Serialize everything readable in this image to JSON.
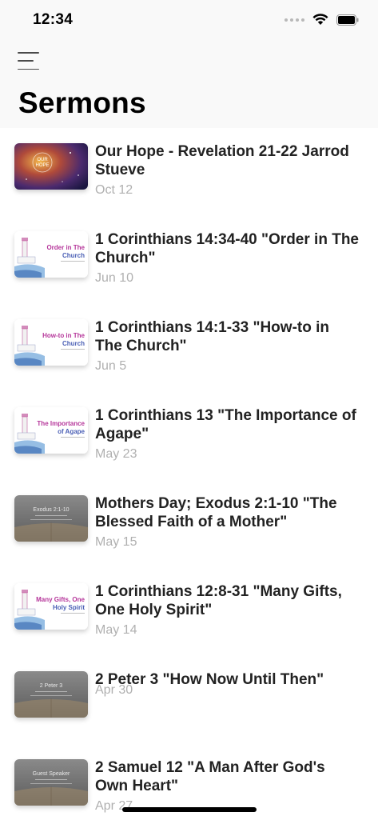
{
  "status_bar": {
    "time": "12:34"
  },
  "header": {
    "title": "Sermons"
  },
  "sermons": [
    {
      "title": "Our Hope - Revelation 21-22 Jarrod Stueve",
      "date": "Oct 12",
      "thumb": {
        "style": "space",
        "line1": "OUR",
        "line2": "HOPE",
        "caption": ""
      }
    },
    {
      "title": "1 Corinthians 14:34-40 \"Order in The Church\"",
      "date": "Jun 10",
      "thumb": {
        "style": "lighthouse",
        "line1": "Order in The",
        "line2": "Church",
        "caption": ""
      }
    },
    {
      "title": "1 Corinthians 14:1-33 \"How-to in The Church\"",
      "date": "Jun 5",
      "thumb": {
        "style": "lighthouse",
        "line1": "How-to in The",
        "line2": "Church",
        "caption": ""
      }
    },
    {
      "title": "1 Corinthians 13 \"The Importance of Agape\"",
      "date": "May 23",
      "thumb": {
        "style": "lighthouse",
        "line1": "The Importance",
        "line2": "of Agape",
        "caption": ""
      }
    },
    {
      "title": "Mothers Day; Exodus 2:1-10 \"The Blessed Faith of a Mother\"",
      "date": "May 15",
      "thumb": {
        "style": "book",
        "line1": "Exodus 2:1-10",
        "line2": "",
        "caption": ""
      }
    },
    {
      "title": "1 Corinthians 12:8-31 \"Many Gifts, One Holy Spirit\"",
      "date": "May 14",
      "thumb": {
        "style": "lighthouse",
        "line1": "Many Gifts, One",
        "line2": "Holy Spirit",
        "caption": ""
      }
    },
    {
      "title": "2 Peter 3 \"How Now Until Then\"",
      "date": "Apr 30",
      "thumb": {
        "style": "book",
        "line1": "2 Peter 3",
        "line2": "",
        "caption": ""
      }
    },
    {
      "title": "2 Samuel 12 \"A Man After God's Own Heart\"",
      "date": "Apr 27",
      "thumb": {
        "style": "book",
        "line1": "Guest Speaker",
        "line2": "",
        "caption": ""
      }
    }
  ],
  "colors": {
    "lighthouse_text": "#b5359a",
    "date_gray": "#b0b0b0",
    "header_bg": "#f9f9f9"
  }
}
